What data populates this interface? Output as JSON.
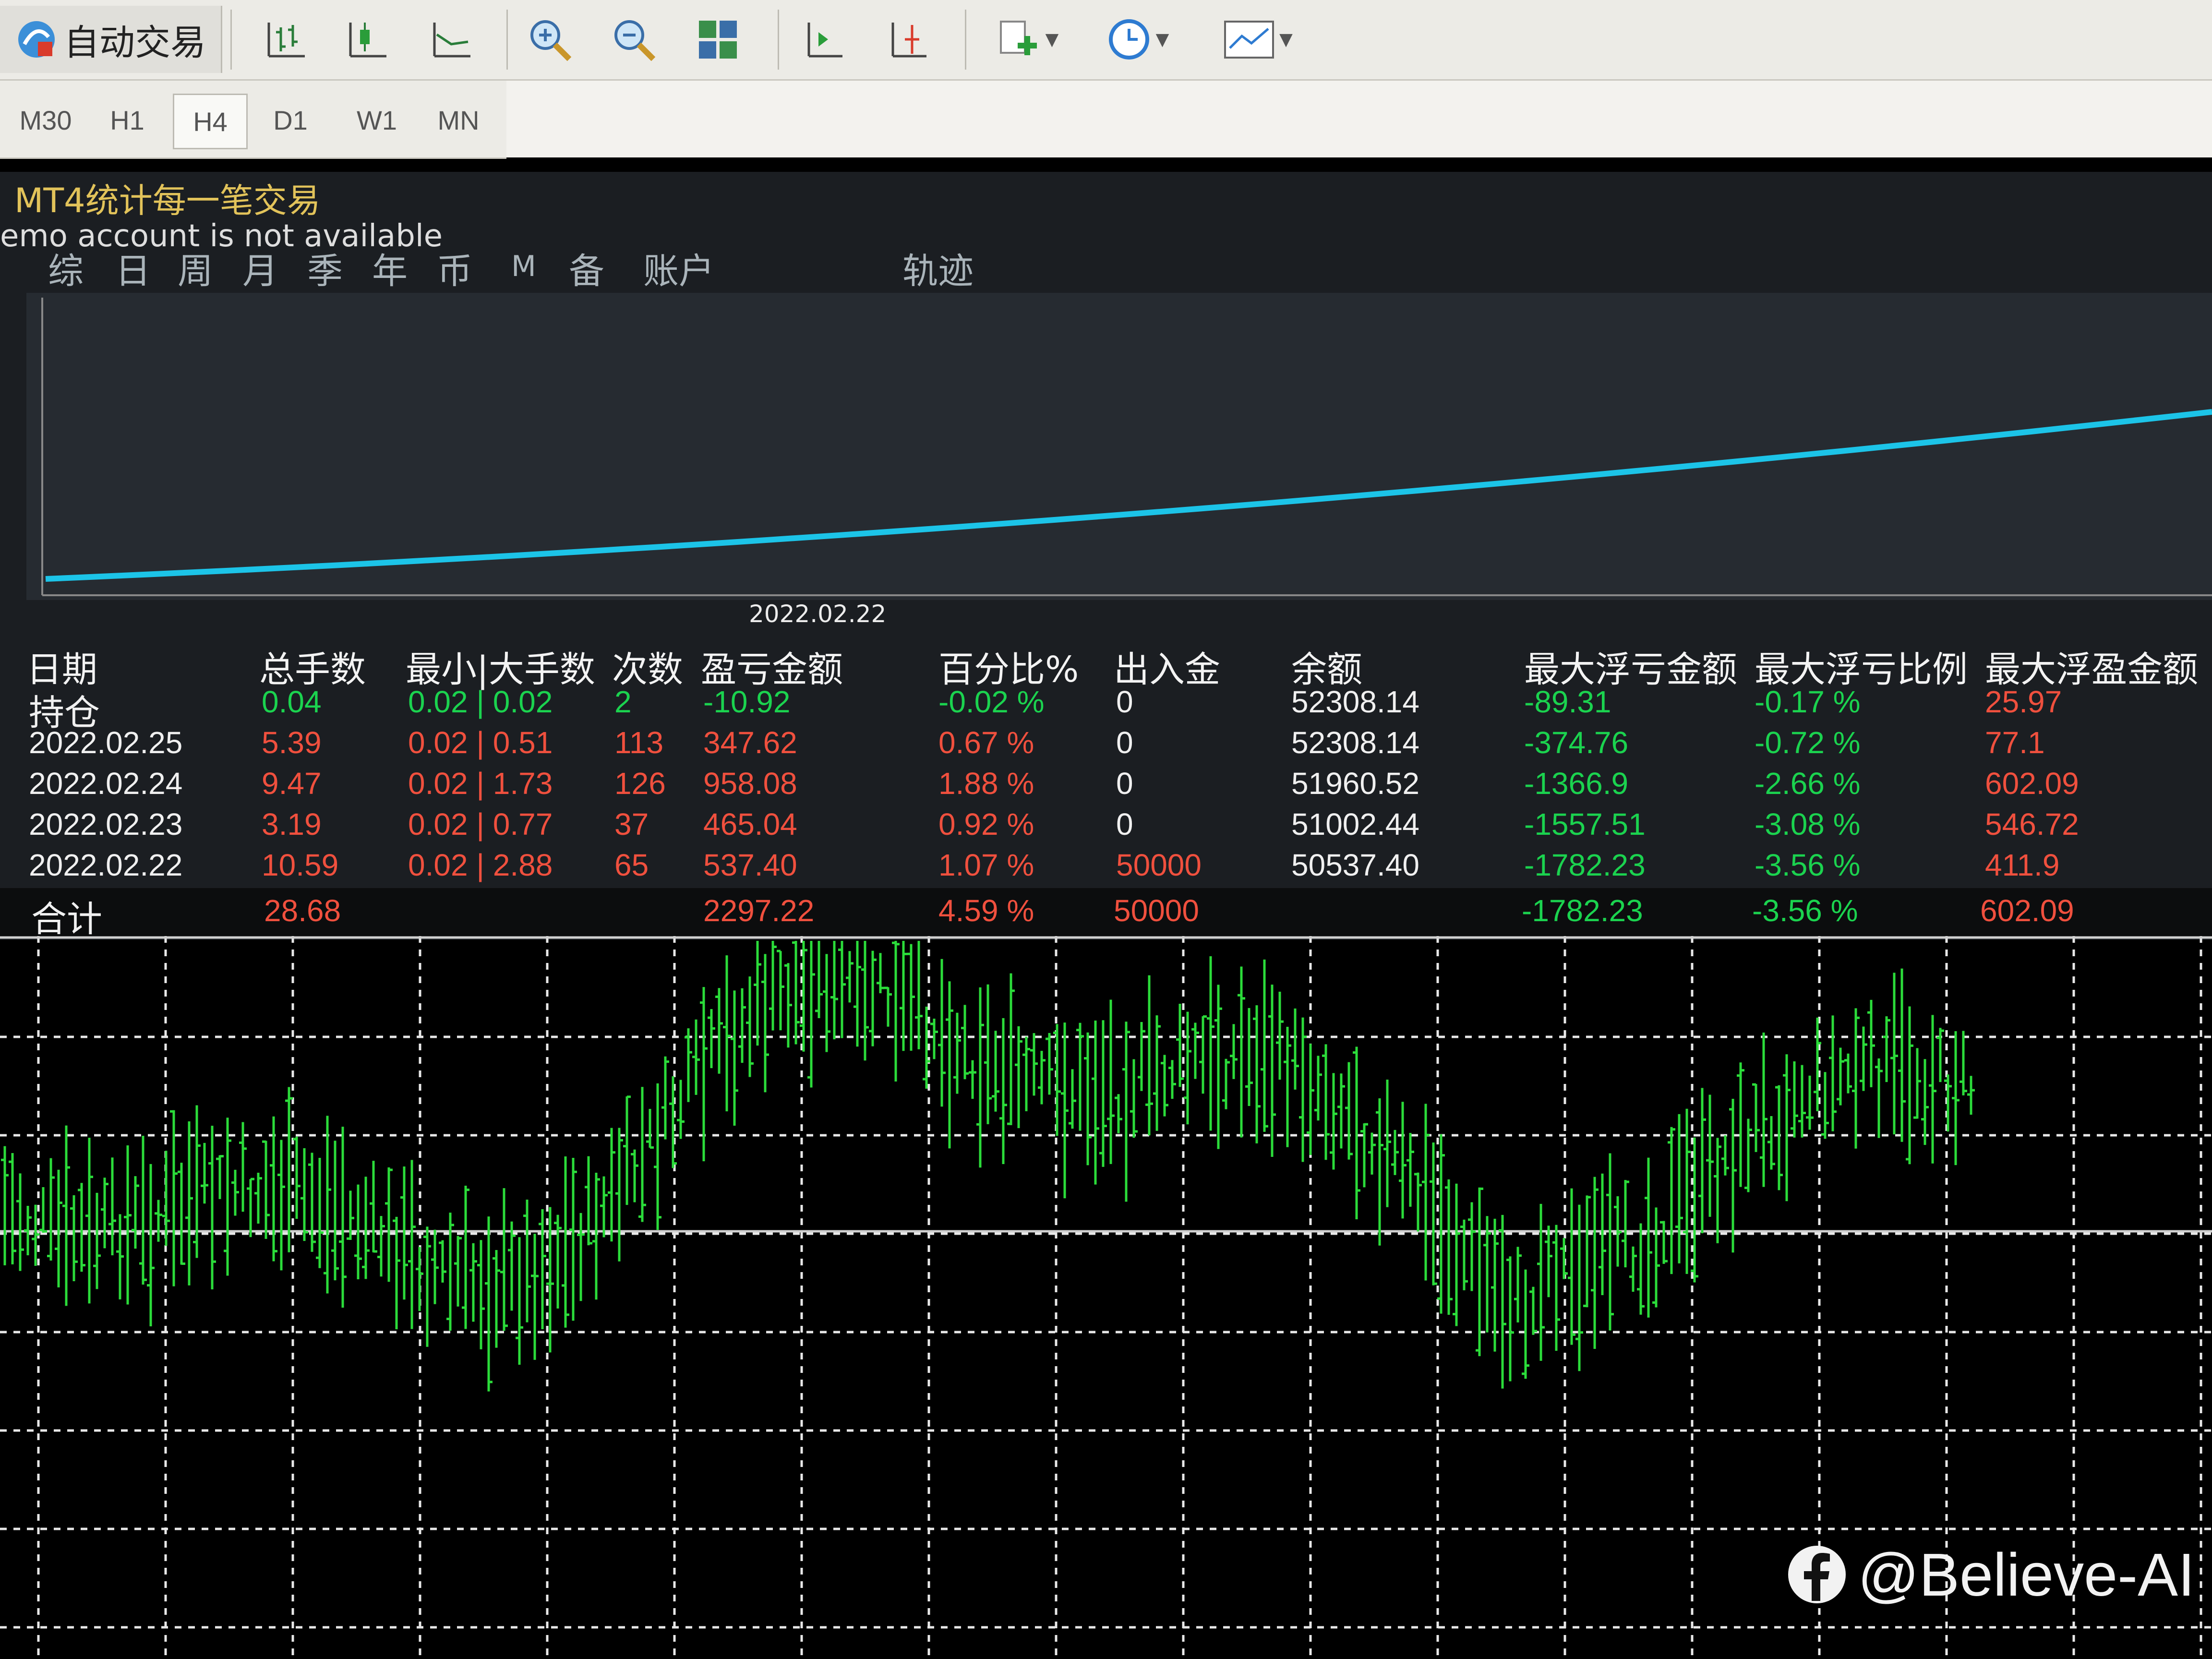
{
  "toolbar": {
    "auto_trade_label": "自动交易",
    "icons": [
      "bar-chart-icon",
      "candlestick-icon",
      "line-chart-icon",
      "zoom-in-icon",
      "zoom-out-icon",
      "tile-windows-icon",
      "chart-shift-icon",
      "autoscroll-icon",
      "indicators-icon",
      "periods-icon",
      "templates-icon"
    ]
  },
  "timeframes": [
    {
      "label": "M30"
    },
    {
      "label": "H1"
    },
    {
      "label": "H4"
    },
    {
      "label": "D1"
    },
    {
      "label": "W1"
    },
    {
      "label": "MN"
    }
  ],
  "active_timeframe": "H4",
  "panel": {
    "title": "MT4统计每一笔交易",
    "subtitle": "emo account is not available",
    "menu": [
      "综",
      "日",
      "周",
      "月",
      "季",
      "年",
      "币",
      "M",
      "备",
      "账户",
      "轨迹"
    ]
  },
  "curve": {
    "date_label": "2022.02.22",
    "line_color": "#1cc4e8",
    "start_level": 0.04,
    "end_level": 0.62
  },
  "table": {
    "headers": [
      "日期",
      "总手数",
      "最小|大手数",
      "次数",
      "盈亏金额",
      "百分比%",
      "出入金",
      "余额",
      "最大浮亏金额",
      "最大浮亏比例",
      "最大浮盈金额"
    ],
    "rows": [
      {
        "date": "持仓",
        "lots": "0.04",
        "minmax": "0.02 | 0.02",
        "count": "2",
        "pnl": "-10.92",
        "pct": "-0.02 %",
        "inout": "0",
        "balance": "52308.14",
        "maxloss": "-89.31",
        "maxlosspct": "-0.17 %",
        "maxprofit": "25.97"
      },
      {
        "date": "2022.02.25",
        "lots": "5.39",
        "minmax": "0.02 | 0.51",
        "count": "113",
        "pnl": "347.62",
        "pct": "0.67 %",
        "inout": "0",
        "balance": "52308.14",
        "maxloss": "-374.76",
        "maxlosspct": "-0.72 %",
        "maxprofit": "77.1"
      },
      {
        "date": "2022.02.24",
        "lots": "9.47",
        "minmax": "0.02 | 1.73",
        "count": "126",
        "pnl": "958.08",
        "pct": "1.88 %",
        "inout": "0",
        "balance": "51960.52",
        "maxloss": "-1366.9",
        "maxlosspct": "-2.66 %",
        "maxprofit": "602.09"
      },
      {
        "date": "2022.02.23",
        "lots": "3.19",
        "minmax": "0.02 | 0.77",
        "count": "37",
        "pnl": "465.04",
        "pct": "0.92 %",
        "inout": "0",
        "balance": "51002.44",
        "maxloss": "-1557.51",
        "maxlosspct": "-3.08 %",
        "maxprofit": "546.72"
      },
      {
        "date": "2022.02.22",
        "lots": "10.59",
        "minmax": "0.02 | 2.88",
        "count": "65",
        "pnl": "537.40",
        "pct": "1.07 %",
        "inout": "50000",
        "balance": "50537.40",
        "maxloss": "-1782.23",
        "maxlosspct": "-3.56 %",
        "maxprofit": "411.9"
      }
    ],
    "total": {
      "label": "合计",
      "lots": "28.68",
      "pnl": "2297.22",
      "pct": "4.59 %",
      "inout": "50000",
      "maxloss": "-1782.23",
      "maxlosspct": "-3.56 %",
      "maxprofit": "602.09"
    }
  },
  "colors": {
    "positive": "#f0503e",
    "negative": "#1bd34f",
    "bars": "#2bdc3a",
    "title": "#e2c35a"
  },
  "watermark": {
    "text": "@Believe-AI",
    "icon": "facebook-icon"
  }
}
